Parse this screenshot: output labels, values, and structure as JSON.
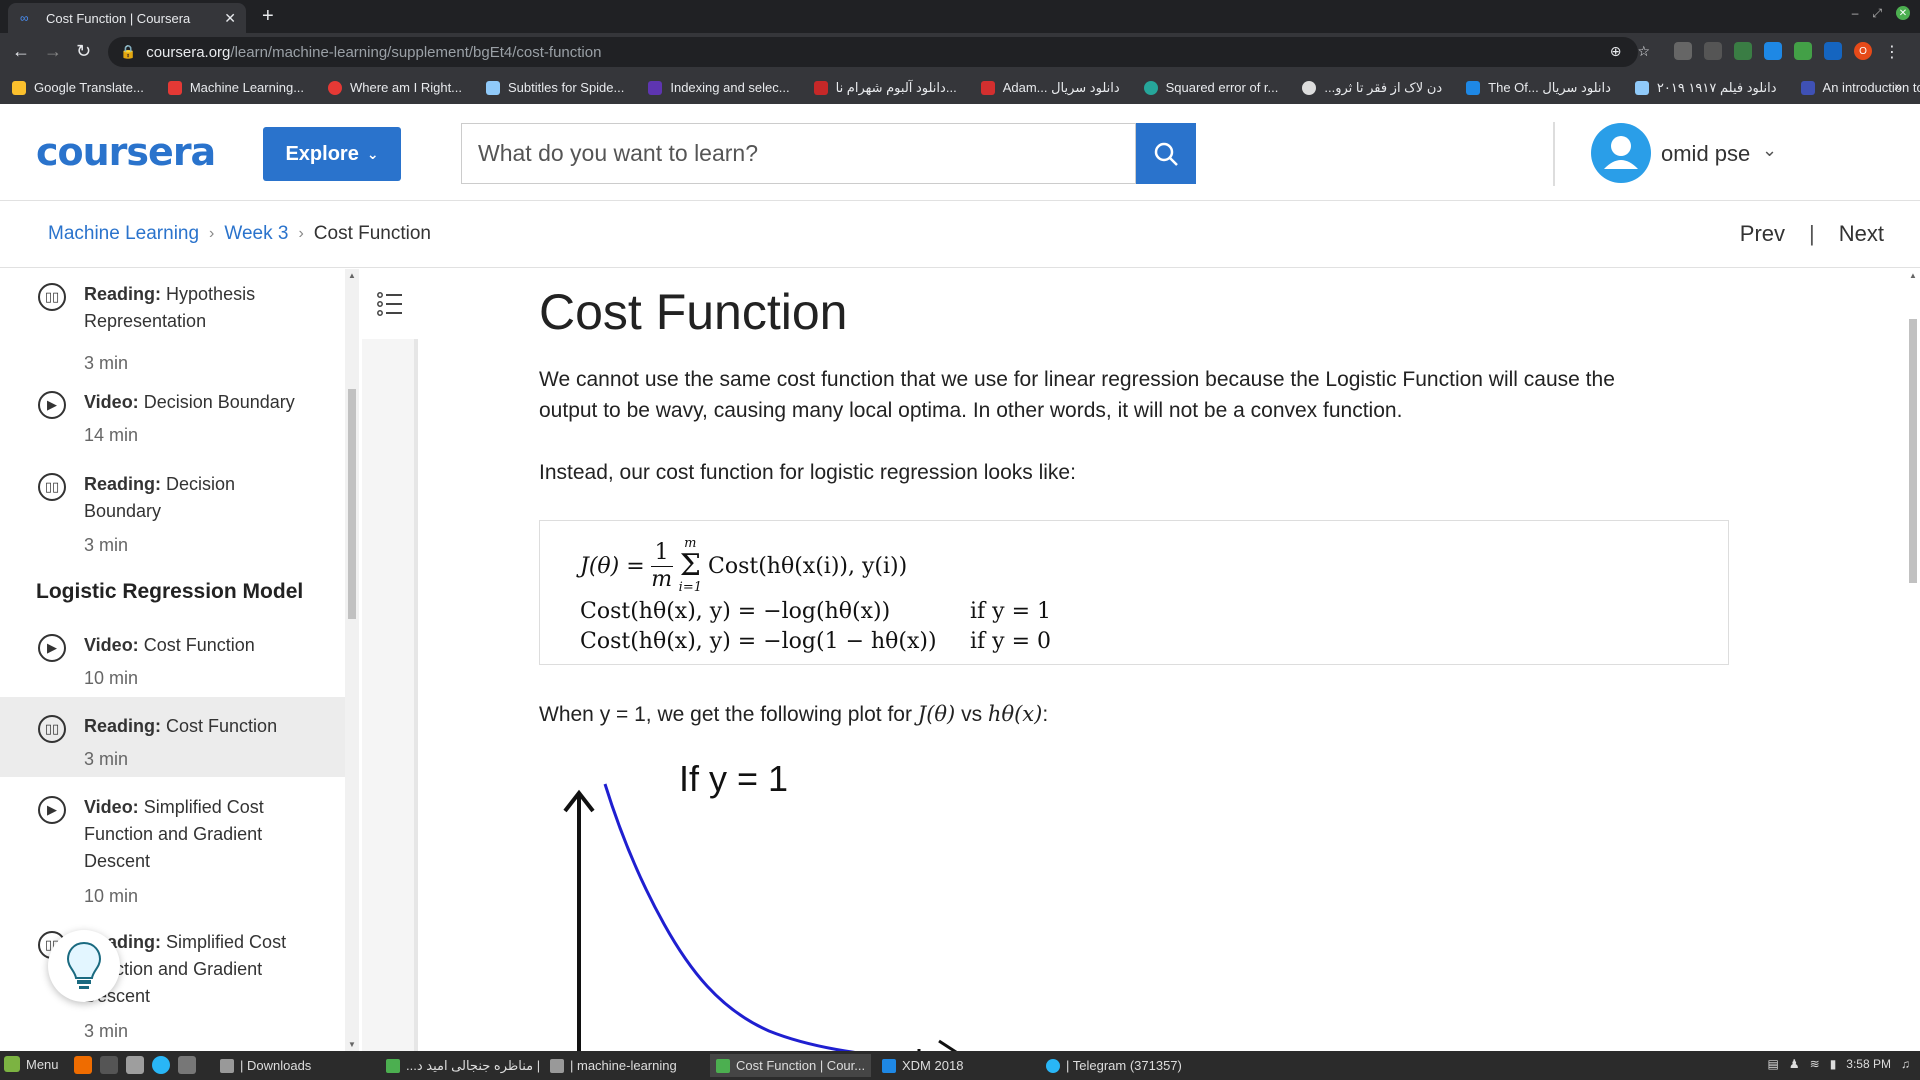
{
  "browser": {
    "tab_title": "Cost Function | Coursera",
    "url_domain": "coursera.org",
    "url_path": "/learn/machine-learning/supplement/bgEt4/cost-function",
    "bookmarks": [
      "Google Translate...",
      "Machine Learning...",
      "Where am I Right...",
      "Subtitles for Spide...",
      "Indexing and selec...",
      "دانلود آلبوم شهرام نا...",
      "Adam... دانلود سریال",
      "Squared error of r...",
      "...دن لاک از فقر تا ثرو",
      "The Of... دانلود سریال",
      "دانلود فیلم ۱۹۱۷ ۲۰۱۹",
      "An introduction to..."
    ],
    "bookmarks_more": "»"
  },
  "header": {
    "logo": "coursera",
    "explore_label": "Explore",
    "search_placeholder": "What do you want to learn?",
    "username": "omid pse"
  },
  "breadcrumb": {
    "course": "Machine Learning",
    "week": "Week 3",
    "current": "Cost Function",
    "prev": "Prev",
    "next": "Next",
    "separator": "|"
  },
  "sidebar": {
    "items": [
      {
        "type": "Reading:",
        "title": "Hypothesis Representation",
        "duration": "3 min"
      },
      {
        "type": "Video:",
        "title": "Decision Boundary",
        "duration": "14 min"
      },
      {
        "type": "Reading:",
        "title": "Decision Boundary",
        "duration": "3 min"
      },
      {
        "type": "Video:",
        "title": "Cost Function",
        "duration": "10 min"
      },
      {
        "type": "Reading:",
        "title": "Cost Function",
        "duration": "3 min"
      },
      {
        "type": "Video:",
        "title": "Simplified Cost Function and Gradient Descent",
        "duration": "10 min"
      },
      {
        "type": "Reading:",
        "title": "Simplified Cost Function and Gradient Descent",
        "duration": "3 min"
      }
    ],
    "section_title": "Logistic Regression Model"
  },
  "content": {
    "title": "Cost Function",
    "para1": "We cannot use the same cost function that we use for linear regression because the Logistic Function will cause the output to be wavy, causing many local optima. In other words, it will not be a convex function.",
    "para2": "Instead, our cost function for logistic regression looks like:",
    "para3_prefix": "When y = 1, we get the following plot for ",
    "para3_math1": "J(θ)",
    "para3_mid": " vs ",
    "para3_math2": "hθ(x)",
    "para3_suffix": ":",
    "formula": {
      "line1_lhs": "J(θ) =",
      "line1_num": "1",
      "line1_den": "m",
      "sum_top": "m",
      "sum_bottom": "i=1",
      "line1_rhs": "Cost(hθ(x(i)), y(i))",
      "line2": "Cost(hθ(x), y) = −log(hθ(x))",
      "line2_cond": "if y = 1",
      "line3": "Cost(hθ(x), y) = −log(1 − hθ(x))",
      "line3_cond": "if y = 0"
    },
    "plot_label": "If y = 1"
  },
  "taskbar": {
    "menu": "Menu",
    "tasks": [
      "| Downloads",
      "...مناظره جنجالی امید د |",
      "| machine-learning",
      "Cost Function | Cour...",
      "XDM 2018",
      "| Telegram (371357)"
    ],
    "clock": "3:58 PM"
  },
  "colors": {
    "brand": "#2a73cc",
    "avatar": "#2a9ee8",
    "curve": "#1f1fd0"
  }
}
